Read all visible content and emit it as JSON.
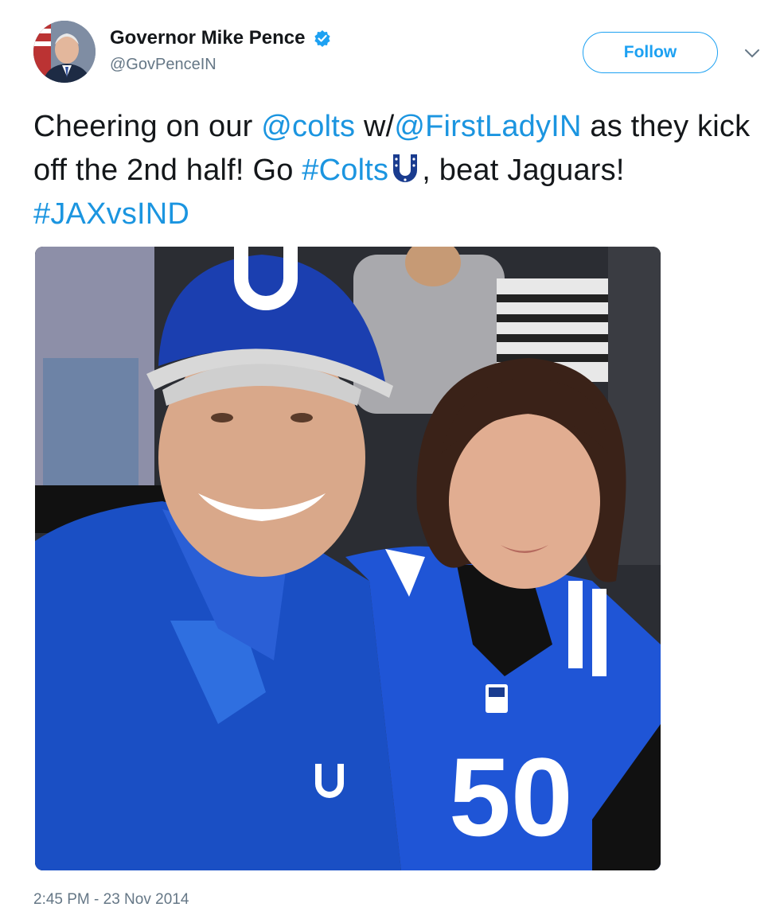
{
  "author": {
    "display_name": "Governor Mike Pence",
    "handle": "@GovPenceIN",
    "verified_icon": "verified-badge-icon",
    "avatar_icon": "avatar-photo"
  },
  "follow_button": {
    "label": "Follow"
  },
  "menu_icon": "chevron-down-icon",
  "tweet": {
    "t1": "Cheering on our ",
    "mention1": "@colts",
    "t2": " w/",
    "mention2": "@FirstLadyIN",
    "t3": " as they kick off the 2nd half! Go ",
    "hashtag1": "#Colts",
    "emoji_icon": "horseshoe-icon",
    "t4": ", beat Jaguars! ",
    "hashtag2": "#JAXvsIND"
  },
  "media": {
    "jersey_number": "50",
    "type": "photo"
  },
  "timestamp": "2:45 PM - 23 Nov 2014",
  "colors": {
    "link": "#1b95e0",
    "follow_border": "#1da1f2",
    "colts_blue": "#1a4fc4",
    "secondary_text": "#657786"
  }
}
